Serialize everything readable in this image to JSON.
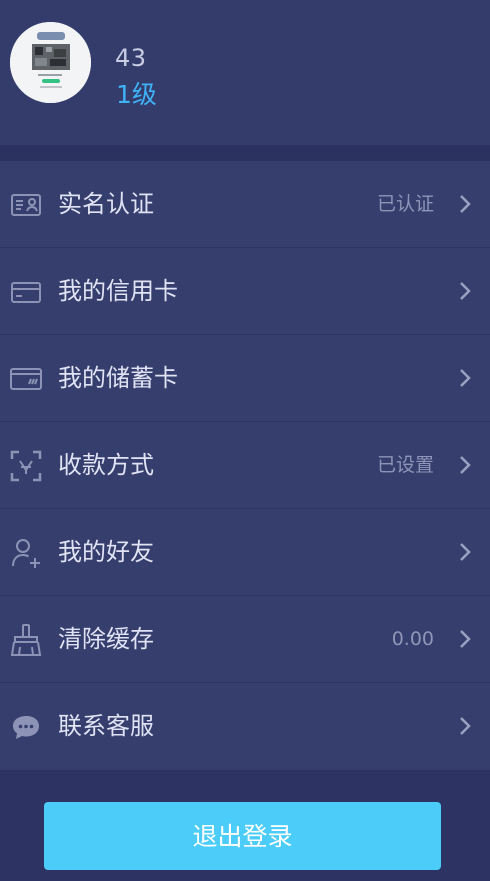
{
  "profile": {
    "uid": "43",
    "level": "1级"
  },
  "menu": {
    "items": [
      {
        "label": "实名认证",
        "value": "已认证",
        "icon": "id-card-icon"
      },
      {
        "label": "我的信用卡",
        "value": "",
        "icon": "credit-card-icon"
      },
      {
        "label": "我的储蓄卡",
        "value": "",
        "icon": "debit-card-icon"
      },
      {
        "label": "收款方式",
        "value": "已设置",
        "icon": "payment-method-icon"
      },
      {
        "label": "我的好友",
        "value": "",
        "icon": "add-friend-icon"
      },
      {
        "label": "清除缓存",
        "value": "0.00",
        "icon": "broom-icon"
      },
      {
        "label": "联系客服",
        "value": "",
        "icon": "chat-bubble-icon"
      }
    ]
  },
  "actions": {
    "logout_label": "退出登录"
  },
  "colors": {
    "background": "#2d3463",
    "card": "#363e6e",
    "accent": "#3eb3f7",
    "button": "#4ccdf9",
    "muted_text": "#8e95b8"
  }
}
